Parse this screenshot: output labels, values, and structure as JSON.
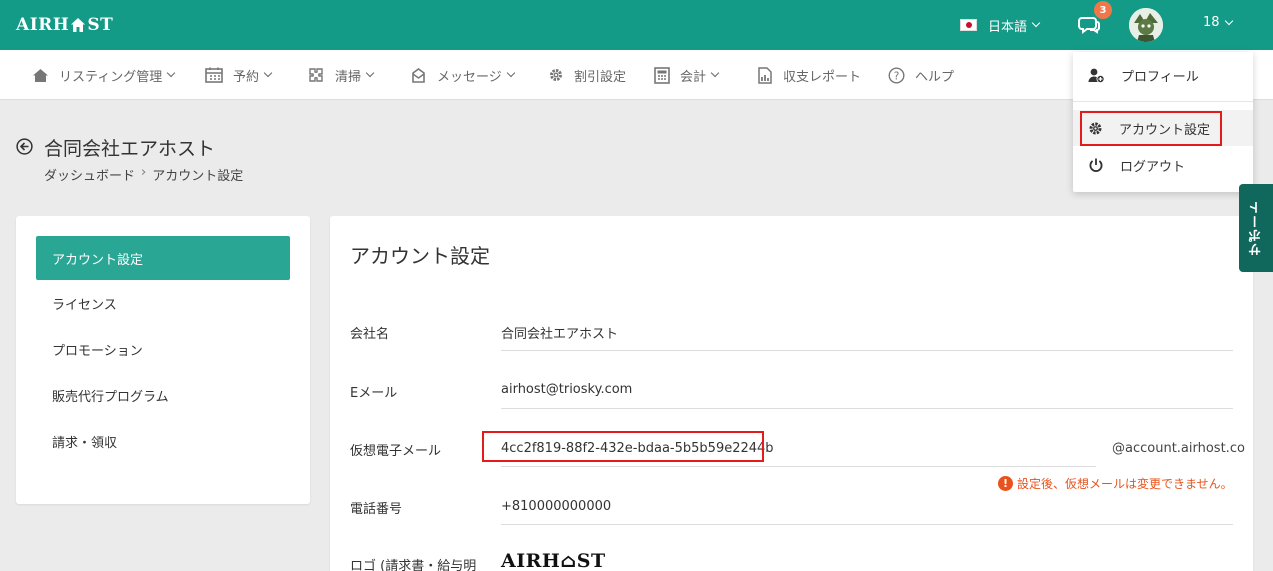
{
  "header": {
    "logo_text_left": "AIRH",
    "logo_text_right": "ST",
    "language": "日本語",
    "message_count": "3",
    "user_label": "18"
  },
  "nav": [
    {
      "label": "リスティング管理",
      "icon": "home-icon",
      "has_caret": true
    },
    {
      "label": "予約",
      "icon": "calendar-icon",
      "has_caret": true
    },
    {
      "label": "清掃",
      "icon": "cleaning-icon",
      "has_caret": true
    },
    {
      "label": "メッセージ",
      "icon": "message-icon",
      "has_caret": true
    },
    {
      "label": "割引設定",
      "icon": "gear-icon",
      "has_caret": false
    },
    {
      "label": "会計",
      "icon": "calculator-icon",
      "has_caret": true
    },
    {
      "label": "収支レポート",
      "icon": "report-icon",
      "has_caret": false
    },
    {
      "label": "ヘルプ",
      "icon": "help-icon",
      "has_caret": false
    }
  ],
  "page": {
    "title": "合同会社エアホスト",
    "breadcrumb_home": "ダッシュボード",
    "breadcrumb_sep": "›",
    "breadcrumb_current": "アカウント設定"
  },
  "sidebar": {
    "items": [
      {
        "label": "アカウント設定",
        "active": true
      },
      {
        "label": "ライセンス",
        "active": false
      },
      {
        "label": "プロモーション",
        "active": false
      },
      {
        "label": "販売代行プログラム",
        "active": false
      },
      {
        "label": "請求・領収",
        "active": false
      }
    ]
  },
  "account": {
    "title": "アカウント設定",
    "company_label": "会社名",
    "company_value": "合同会社エアホスト",
    "email_label": "Eメール",
    "email_value": "airhost@triosky.com",
    "virtual_label": "仮想電子メール",
    "virtual_value": "4cc2f819-88f2-432e-bdaa-5b5b59e2244b",
    "virtual_suffix": "@account.airhost.co",
    "virtual_warning": "設定後、仮想メールは変更できません。",
    "phone_label": "電話番号",
    "phone_value": "+810000000000",
    "logo_label": "ロゴ (請求書・給与明",
    "logo_text": "AIRH⌂ST"
  },
  "user_menu": {
    "items": [
      {
        "label": "プロフィール",
        "icon": "profile-icon"
      },
      {
        "label": "アカウント設定",
        "icon": "gear-icon"
      },
      {
        "label": "ログアウト",
        "icon": "power-icon"
      }
    ]
  },
  "support_tab": "サポート",
  "colors": {
    "header": "#139b87",
    "active_sidebar": "#2aa694",
    "highlight_box": "#e31b1b",
    "warning": "#e8531d",
    "support_tab": "#10685d"
  }
}
